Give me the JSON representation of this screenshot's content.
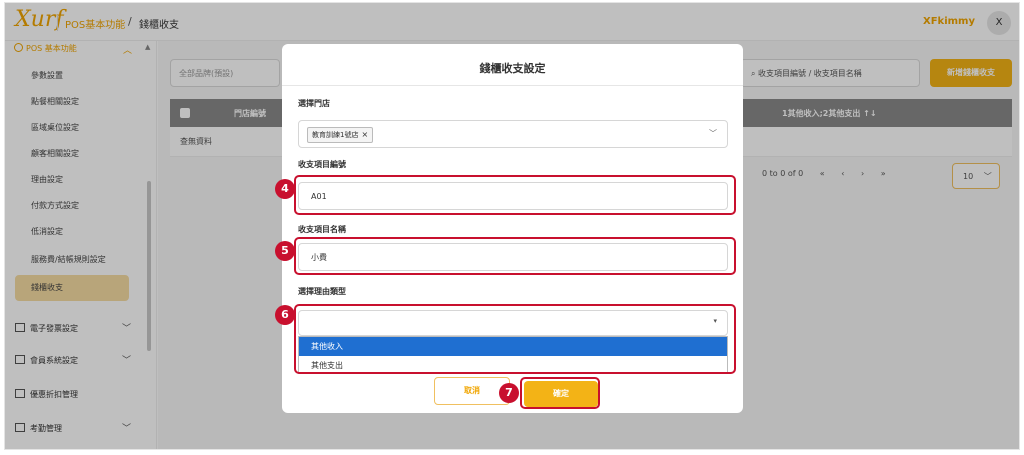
{
  "header": {
    "logo_text": "Xurf",
    "breadcrumb": [
      "POS基本功能",
      "錢櫃收支"
    ],
    "breadcrumb_sep": "/",
    "username": "XFkimmy",
    "avatar_letter": "X"
  },
  "sidebar": {
    "section_label": "POS 基本功能",
    "items": [
      {
        "label": "參數設置"
      },
      {
        "label": "點餐相關設定"
      },
      {
        "label": "區域桌位設定"
      },
      {
        "label": "顧客相關設定"
      },
      {
        "label": "理由設定"
      },
      {
        "label": "付款方式設定"
      },
      {
        "label": "低消設定"
      },
      {
        "label": "服務費/結帳規則設定"
      },
      {
        "label": "錢櫃收支"
      }
    ],
    "active_item": "錢櫃收支",
    "groups": [
      {
        "label": "電子發票設定"
      },
      {
        "label": "會員系統設定"
      },
      {
        "label": "優惠折扣管理"
      },
      {
        "label": "考勤管理"
      }
    ]
  },
  "main": {
    "brand_placeholder": "全部品牌(預設)",
    "search_placeholder": "收支項目編號 / 收支項目名稱",
    "add_button": "新增錢櫃收支",
    "columns": [
      "門店編號",
      "1其他收入;2其他支出 ↑↓"
    ],
    "empty_text": "查無資料",
    "pager": [
      "0 to 0 of 0",
      "«",
      "‹",
      "›",
      "»"
    ],
    "page_size": "10"
  },
  "modal": {
    "title": "錢櫃收支設定",
    "store_label": "選擇門店",
    "store_chip": "教育訓練1號店",
    "store_chip_remove": "×",
    "code_label": "收支項目編號",
    "code_value": "A01",
    "name_label": "收支項目名稱",
    "name_value": "小費",
    "reason_label": "選擇理由類型",
    "reason_options": [
      "其他收入",
      "其他支出"
    ],
    "cancel_label": "取消",
    "confirm_label": "確定"
  },
  "annotations": [
    "4",
    "5",
    "6",
    "7"
  ],
  "colors": {
    "accent": "#f3b316",
    "annotation": "#c8102e",
    "selected_option": "#1f6fd1"
  }
}
